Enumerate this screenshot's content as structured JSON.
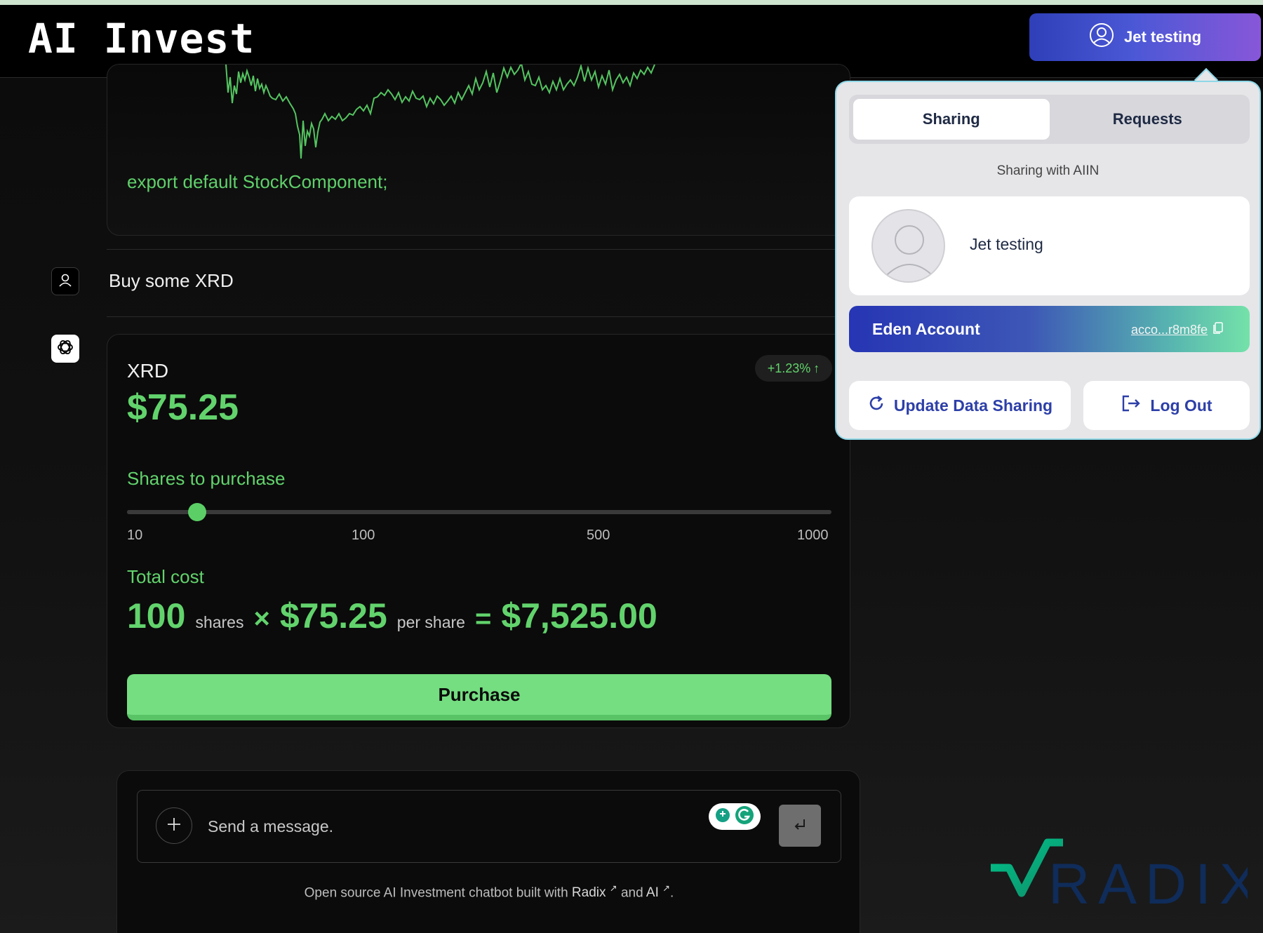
{
  "app": {
    "title": "AI Invest"
  },
  "header": {
    "user_button_label": "Jet testing"
  },
  "chat": {
    "code_line": "export default StockComponent;",
    "user_message": "Buy some XRD",
    "stock": {
      "symbol": "XRD",
      "price": "$75.25",
      "change": "+1.23%",
      "shares_label": "Shares to purchase",
      "slider": {
        "min": 10,
        "max": 1000,
        "value": 100,
        "ticks": [
          "10",
          "100",
          "500",
          "1000"
        ]
      },
      "total_label": "Total cost",
      "total": {
        "shares": "100",
        "shares_unit": "shares",
        "times": "×",
        "unit_price": "$75.25",
        "per_share": "per share",
        "equals": "=",
        "total_cost": "$7,525.00"
      },
      "purchase_label": "Purchase"
    },
    "input": {
      "placeholder": "Send a message."
    },
    "footer": {
      "prefix": "Open source AI Investment chatbot built with",
      "link1": "Radix",
      "middle": "and",
      "link2": "AI",
      "suffix": "."
    }
  },
  "dropdown": {
    "tabs": [
      {
        "label": "Sharing",
        "active": true
      },
      {
        "label": "Requests",
        "active": false
      }
    ],
    "sharing_with": "Sharing with AIIN",
    "profile_name": "Jet testing",
    "eden": {
      "label": "Eden Account",
      "account": "acco...r8m8fe"
    },
    "update_label": "Update Data Sharing",
    "logout_label": "Log Out"
  },
  "logo": {
    "text": "RADIX"
  },
  "colors": {
    "accent_green": "#62d36c",
    "purchase_green": "#74de80",
    "link_blue": "#2d3fa8"
  }
}
